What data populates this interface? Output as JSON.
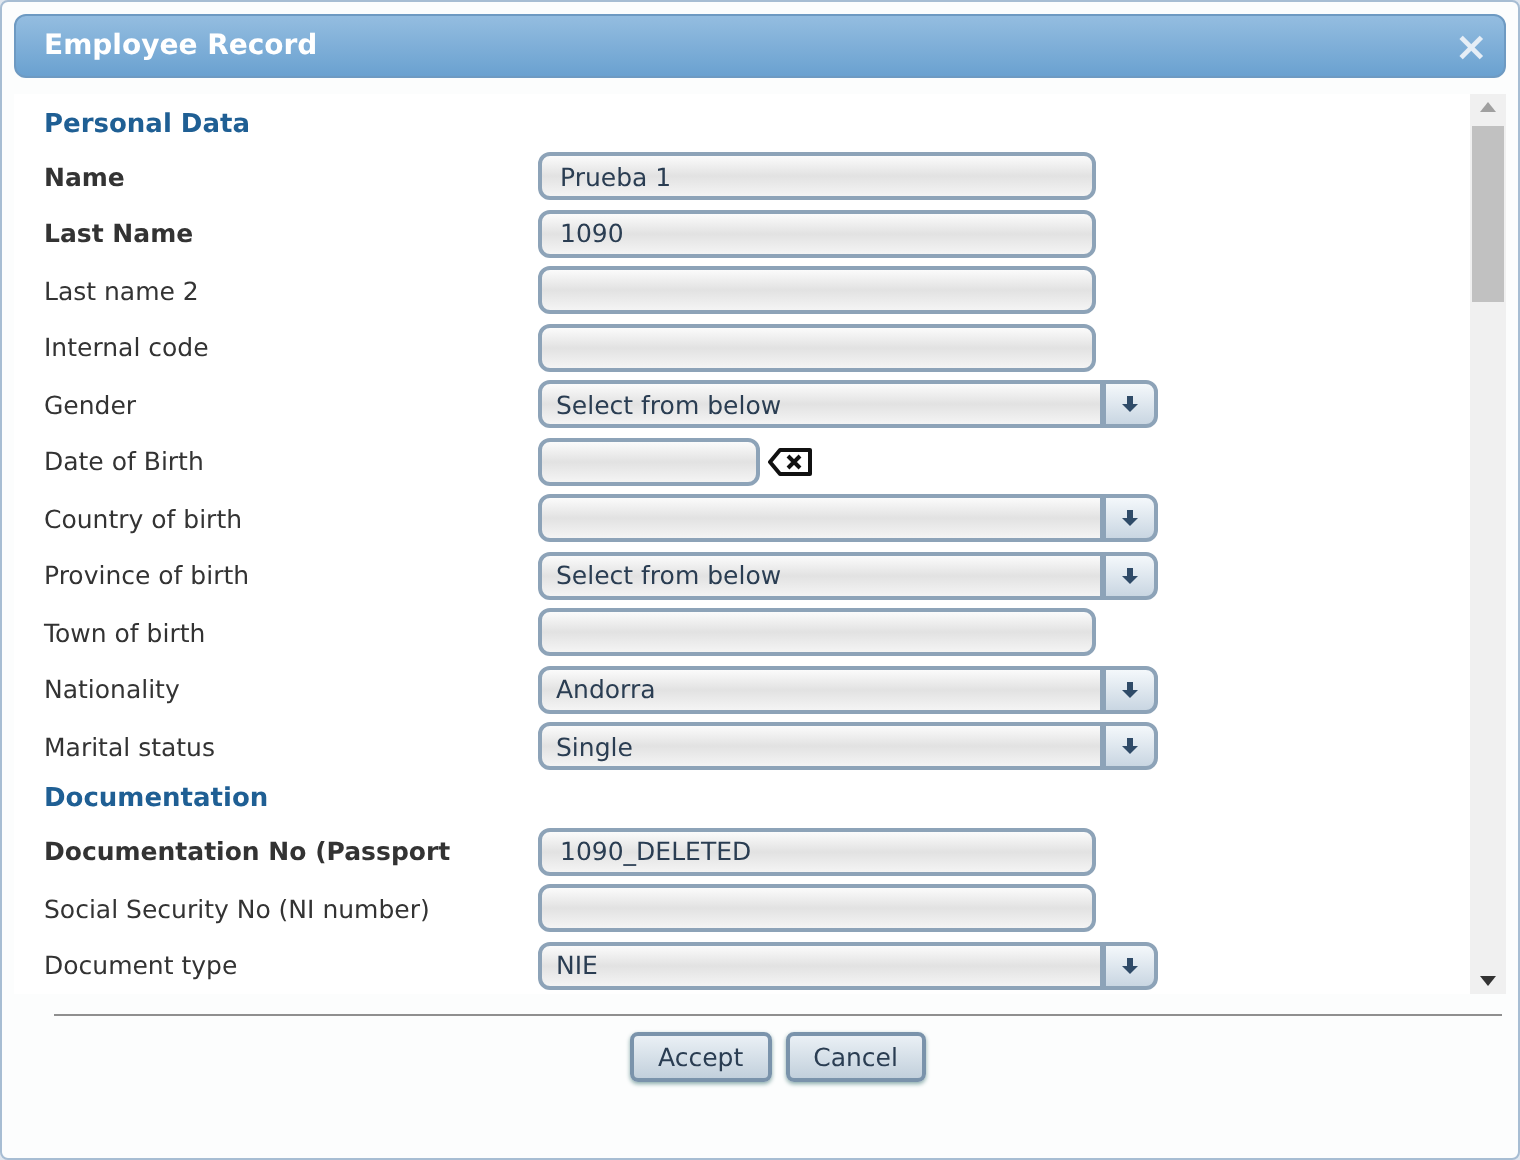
{
  "window": {
    "title": "Employee Record",
    "close": "×"
  },
  "rows": [
    {
      "kind": "heading",
      "label": "Personal Data"
    },
    {
      "kind": "text",
      "label": "Name",
      "required": true,
      "value": "Prueba 1"
    },
    {
      "kind": "text",
      "label": "Last Name",
      "required": true,
      "value": "1090"
    },
    {
      "kind": "text",
      "label": "Last name 2",
      "required": false
    },
    {
      "kind": "text",
      "label": "Internal code",
      "required": false
    },
    {
      "kind": "select",
      "label": "Gender",
      "required": false,
      "value": "Select from below"
    },
    {
      "kind": "date",
      "label": "Date of Birth",
      "required": false
    },
    {
      "kind": "select",
      "label": "Country of birth",
      "required": false
    },
    {
      "kind": "select",
      "label": "Province of birth",
      "required": false,
      "value": "Select from below"
    },
    {
      "kind": "text",
      "label": "Town of birth",
      "required": false
    },
    {
      "kind": "select",
      "label": "Nationality",
      "required": false,
      "value": "Andorra"
    },
    {
      "kind": "select",
      "label": "Marital status",
      "required": false,
      "value": "Single"
    },
    {
      "kind": "heading",
      "label": "Documentation"
    },
    {
      "kind": "text",
      "label": "Documentation No (Passport",
      "required": true,
      "value": "1090_DELETED"
    },
    {
      "kind": "text",
      "label": "Social Security No (NI number)",
      "required": false
    },
    {
      "kind": "select",
      "label": "Document type",
      "required": false,
      "value": "NIE"
    }
  ],
  "buttons": [
    "Accept",
    "Cancel"
  ]
}
